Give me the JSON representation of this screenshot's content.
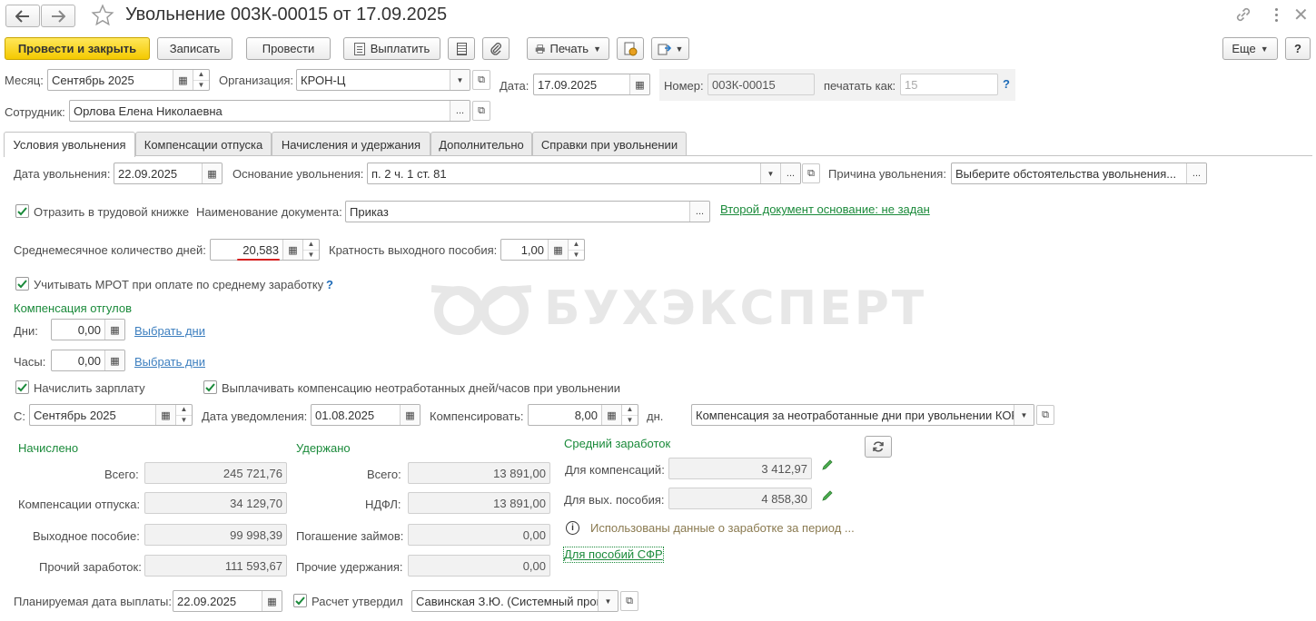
{
  "window": {
    "title": "Увольнение 003К-00015 от 17.09.2025"
  },
  "toolbar": {
    "post_close": "Провести и закрыть",
    "save": "Записать",
    "post": "Провести",
    "pay": "Выплатить",
    "print": "Печать",
    "more": "Еще",
    "help": "?"
  },
  "header": {
    "month_label": "Месяц:",
    "month_value": "Сентябрь 2025",
    "org_label": "Организация:",
    "org_value": "КРОН-Ц",
    "date_label": "Дата:",
    "date_value": "17.09.2025",
    "number_label": "Номер:",
    "number_value": "003К-00015",
    "print_as_label": "печатать как:",
    "print_as_value": "15",
    "employee_label": "Сотрудник:",
    "employee_value": "Орлова Елена Николаевна"
  },
  "tabs": [
    {
      "label": "Условия увольнения"
    },
    {
      "label": "Компенсации отпуска"
    },
    {
      "label": "Начисления и удержания"
    },
    {
      "label": "Дополнительно"
    },
    {
      "label": "Справки при увольнении"
    }
  ],
  "conditions": {
    "dismissal_date_label": "Дата увольнения:",
    "dismissal_date_value": "22.09.2025",
    "basis_label": "Основание увольнения:",
    "basis_value": "п. 2 ч. 1 ст. 81",
    "reason_label": "Причина увольнения:",
    "reason_value": "Выберите обстоятельства увольнения...",
    "workbook_label": "Отразить в трудовой книжке",
    "docname_label": "Наименование документа:",
    "docname_value": "Приказ",
    "second_doc_link": "Второй документ основание: не задан",
    "avg_days_label": "Среднемесячное количество дней:",
    "avg_days_value": "20,583",
    "multiplicity_label": "Кратность выходного пособия:",
    "multiplicity_value": "1,00",
    "mrot_label": "Учитывать МРОТ при оплате по среднему заработку",
    "comp_absence_header": "Компенсация отгулов",
    "days_label": "Дни:",
    "days_value": "0,00",
    "hours_label": "Часы:",
    "hours_value": "0,00",
    "select_days_link": "Выбрать дни",
    "accrue_salary_label": "Начислить зарплату",
    "pay_comp_label": "Выплачивать компенсацию неотработанных дней/часов при увольнении",
    "from_label": "С:",
    "from_value": "Сентябрь 2025",
    "notice_date_label": "Дата уведомления:",
    "notice_date_value": "01.08.2025",
    "compensate_label": "Компенсировать:",
    "compensate_value": "8,00",
    "days_unit": "дн.",
    "comp_type_value": "Компенсация за неотработанные дни при увольнении КОР"
  },
  "accrued": {
    "header": "Начислено",
    "total_label": "Всего:",
    "total_value": "245 721,76",
    "vacation_label": "Компенсации отпуска:",
    "vacation_value": "34 129,70",
    "severance_label": "Выходное пособие:",
    "severance_value": "99 998,39",
    "other_label": "Прочий заработок:",
    "other_value": "111 593,67"
  },
  "withheld": {
    "header": "Удержано",
    "total_label": "Всего:",
    "total_value": "13 891,00",
    "ndfl_label": "НДФЛ:",
    "ndfl_value": "13 891,00",
    "loans_label": "Погашение займов:",
    "loans_value": "0,00",
    "other_label": "Прочие удержания:",
    "other_value": "0,00"
  },
  "avg_earnings": {
    "header": "Средний заработок",
    "comp_label": "Для компенсаций:",
    "comp_value": "3 412,97",
    "severance_label": "Для вых. пособия:",
    "severance_value": "4 858,30",
    "info_text": "Использованы данные о заработке за период ...",
    "sfr_link": "Для пособий СФР"
  },
  "footer": {
    "pay_date_label": "Планируемая дата выплаты:",
    "pay_date_value": "22.09.2025",
    "approved_label": "Расчет утвердил",
    "approved_value": "Савинская З.Ю. (Системный прог"
  },
  "watermark": "БУХЭКСПЕРТ",
  "colors": {
    "primary_button": "#f4c900",
    "section_header": "#1a8a3a",
    "link": "#3d7fbf",
    "underline_mark": "#d62020"
  }
}
